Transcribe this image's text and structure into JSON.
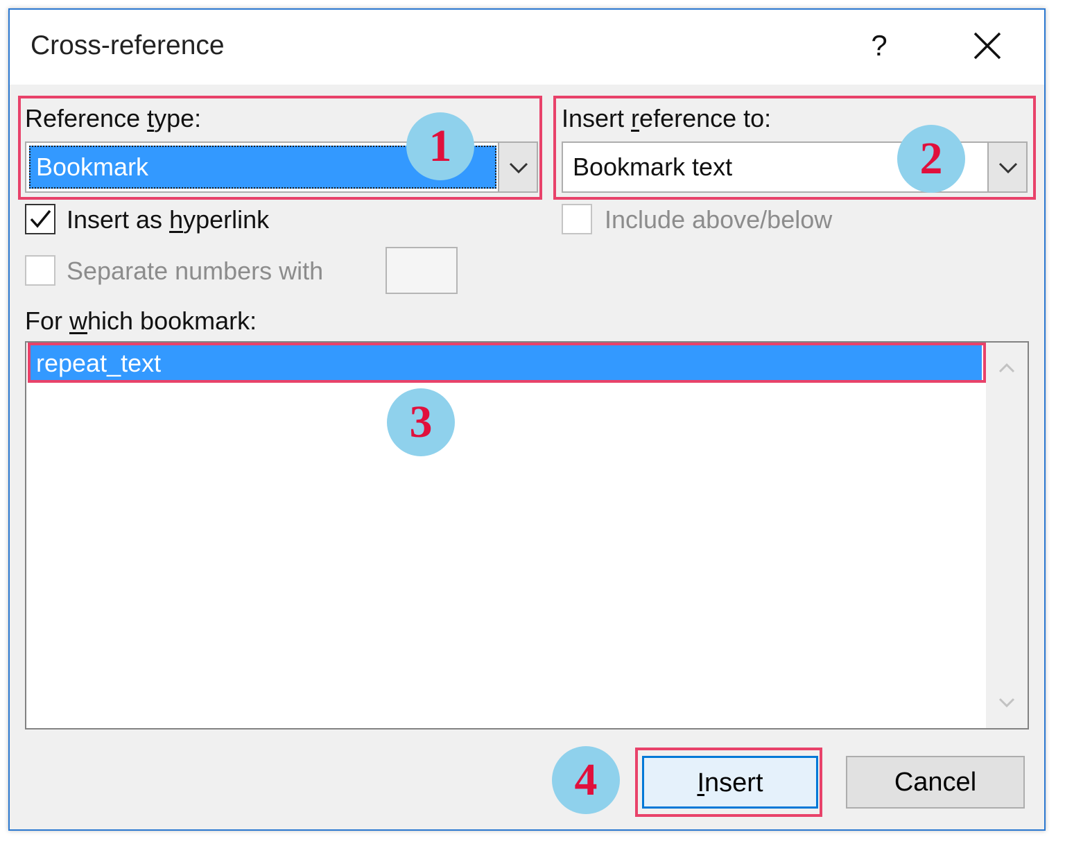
{
  "dialog": {
    "title": "Cross-reference",
    "help_label": "?"
  },
  "reference_type": {
    "label_pre": "Reference ",
    "label_key": "t",
    "label_post": "ype:",
    "value": "Bookmark"
  },
  "insert_reference_to": {
    "label_pre": "Insert ",
    "label_key": "r",
    "label_post": "eference to:",
    "value": "Bookmark text"
  },
  "options": {
    "insert_as_hyperlink": {
      "label_pre": "Insert as ",
      "label_key": "h",
      "label_post": "yperlink",
      "checked": true
    },
    "include_above_below": {
      "label": "Include above/below",
      "checked": false,
      "enabled": false
    },
    "separate_numbers_with": {
      "label": "Separate numbers with",
      "checked": false,
      "enabled": false
    }
  },
  "bookmark_list": {
    "label_pre": "For ",
    "label_key": "w",
    "label_post": "hich bookmark:",
    "items": [
      "repeat_text"
    ],
    "selected_index": 0
  },
  "buttons": {
    "insert_key": "I",
    "insert_rest": "nsert",
    "cancel": "Cancel"
  },
  "step_markers": [
    "1",
    "2",
    "3",
    "4"
  ],
  "colors": {
    "selection": "#3399ff",
    "highlight_border": "#e8426a",
    "marker_fill": "#8fd1ec",
    "marker_text": "#e0103c",
    "dialog_border": "#2b78d0"
  }
}
